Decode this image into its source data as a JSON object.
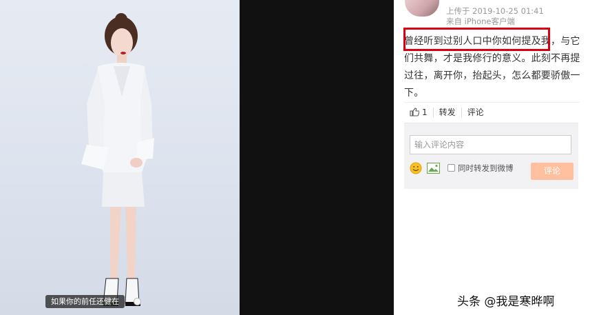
{
  "photo": {
    "caption": "如果你的前任还健在"
  },
  "post": {
    "upload_time": "上传于 2019-10-25 01:41",
    "source": "来自 iPhone客户端",
    "text": "曾经听到过别人口中你如何提及我，与它们共舞，才是我修行的意义。此刻不再提过往，离开你，抬起头，怎么都要骄傲一下。"
  },
  "actions": {
    "like_count": "1",
    "repost_label": "转发",
    "comment_label": "评论"
  },
  "comment": {
    "placeholder": "输入评论内容",
    "repost_checkbox_label": "同时转发到微博",
    "submit_label": "评论"
  },
  "watermark": "头条 @我是寒晔啊",
  "colors": {
    "highlight": "#d7000f",
    "submit_button": "#ffc09f",
    "dark_band": "#111111"
  }
}
